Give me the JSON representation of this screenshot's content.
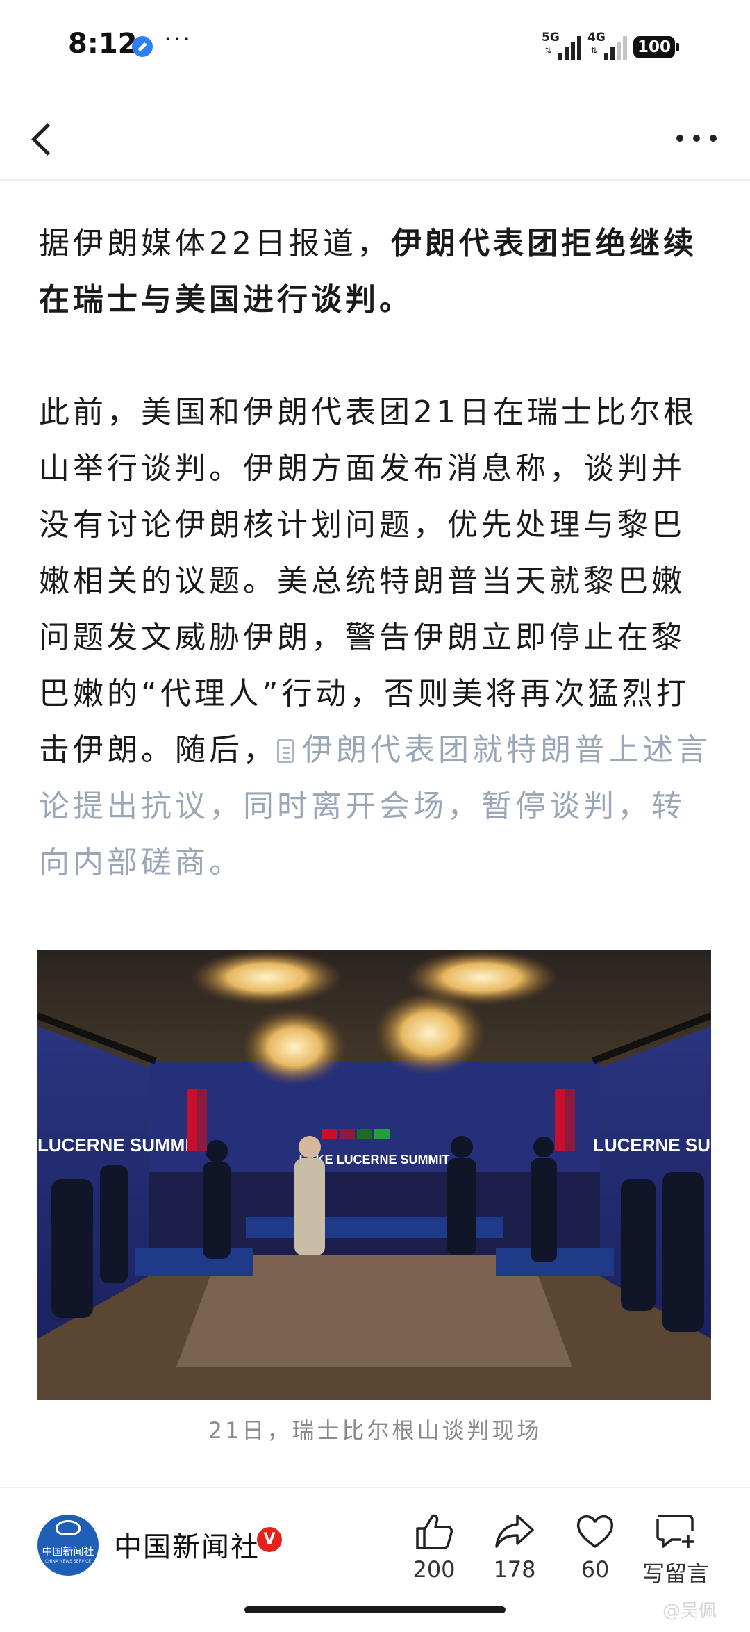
{
  "status_bar": {
    "time": "8:12",
    "dots": "···",
    "network1": "5G",
    "network2": "4G",
    "battery": "100"
  },
  "nav": {
    "back_icon": "chevron-left-icon",
    "more_icon": "more-dots-icon"
  },
  "article": {
    "p1_normal": "据伊朗媒体22日报道，",
    "p1_bold": "伊朗代表团拒绝继续在瑞士与美国进行谈判。",
    "p2_text": "此前，美国和伊朗代表团21日在瑞士比尔根山举行谈判。伊朗方面发布消息称，谈判并没有讨论伊朗核计划问题，优先处理与黎巴嫩相关的议题。美总统特朗普当天就黎巴嫩问题发文威胁伊朗，警告伊朗立即停止在黎巴嫩的“代理人”行动，否则美将再次猛烈打击伊朗。随后，",
    "p2_quoted": "伊朗代表团就特朗普上述言论提出抗议，同时离开会场，暂停谈判，转向内部磋商。"
  },
  "photo": {
    "banner_center": "LAKE LUCERNE SUMMIT",
    "banner_side": "LUCERNE SUMMIT",
    "caption": "21日，瑞士比尔根山谈判现场"
  },
  "bottom_bar": {
    "avatar_text": "中国新闻社",
    "avatar_sub": "CHINA NEWS SERVICE",
    "author": "中国新闻社",
    "verified": "V",
    "like_count": "200",
    "share_count": "178",
    "fav_count": "60",
    "comment_label": "写留言",
    "watermark": "@吴佩"
  },
  "colors": {
    "muted_text": "#9aa7b8",
    "verified": "#e8201c",
    "avatar_bg": "#1f5fb8"
  }
}
